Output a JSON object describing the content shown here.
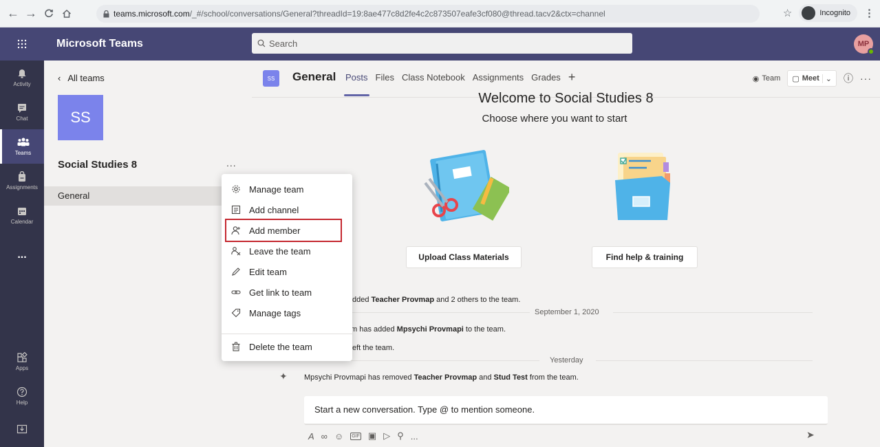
{
  "browser": {
    "url_host": "teams.microsoft.com",
    "url_path": "/_#/school/conversations/General?threadId=19:8ae477c8d2fe4c2c873507eafe3cf080@thread.tacv2&ctx=channel",
    "incognito_label": "Incognito"
  },
  "header": {
    "app_title": "Microsoft Teams",
    "search_placeholder": "Search",
    "avatar_initials": "MP"
  },
  "rail": {
    "items": [
      {
        "label": "Activity"
      },
      {
        "label": "Chat"
      },
      {
        "label": "Teams"
      },
      {
        "label": "Assignments"
      },
      {
        "label": "Calendar"
      },
      {
        "label": "..."
      },
      {
        "label": "Apps"
      },
      {
        "label": "Help"
      }
    ]
  },
  "team_panel": {
    "back_label": "All teams",
    "team_initials": "SS",
    "team_name": "Social Studies 8",
    "more": "...",
    "channel": "General"
  },
  "channel": {
    "badge": "SS",
    "title": "General",
    "tabs": [
      "Posts",
      "Files",
      "Class Notebook",
      "Assignments",
      "Grades",
      "+"
    ],
    "team_btn": "Team",
    "meet_btn": "Meet"
  },
  "welcome": {
    "title": "Welcome to Social Studies 8",
    "subtitle": "Choose where you want to start",
    "upload_btn": "Upload Class Materials",
    "help_btn": "Find help & training"
  },
  "feed": {
    "line1_pre": "dded ",
    "line1_bold": "Teacher Provmap",
    "line1_post": " and 2 others to the team.",
    "date1": "September 1, 2020",
    "line2_pre": "m has added ",
    "line2_bold": "Mpsychi Provmapi",
    "line2_post": " to the team.",
    "line3": "eft the team.",
    "date2": "Yesterday",
    "line4_a": "Mpsychi Provmapi has removed ",
    "line4_b": "Teacher Provmap",
    "line4_c": " and ",
    "line4_d": "Stud Test",
    "line4_e": " from the team."
  },
  "composer": {
    "placeholder": "Start a new conversation. Type @ to mention someone.",
    "more": "..."
  },
  "menu": {
    "items": [
      {
        "label": "Manage team"
      },
      {
        "label": "Add channel"
      },
      {
        "label": "Add member"
      },
      {
        "label": "Leave the team"
      },
      {
        "label": "Edit team"
      },
      {
        "label": "Get link to team"
      },
      {
        "label": "Manage tags"
      },
      {
        "label": "Delete the team"
      }
    ]
  },
  "colors": {
    "brand": "#464775",
    "rail": "#33344a",
    "accent": "#6264a7",
    "team_tile": "#7b83eb",
    "highlight": "#c4262e"
  }
}
